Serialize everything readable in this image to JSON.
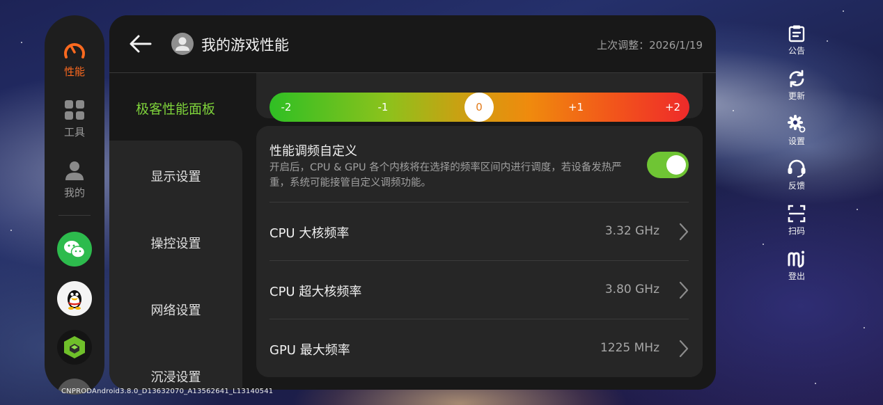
{
  "rail": {
    "items": [
      {
        "label": "性能",
        "icon": "speedometer-icon",
        "active": true
      },
      {
        "label": "工具",
        "icon": "grid-icon"
      },
      {
        "label": "我的",
        "icon": "person-icon"
      }
    ],
    "apps": [
      "wechat-icon",
      "qq-icon",
      "game-app-icon"
    ]
  },
  "header": {
    "title": "我的游戏性能",
    "last_adjust": "上次调整：2026/1/19"
  },
  "subnav": {
    "active": "极客性能面板",
    "items": [
      "显示设置",
      "操控设置",
      "网络设置",
      "沉浸设置"
    ]
  },
  "slider": {
    "ticks": [
      "-2",
      "-1",
      "0",
      "+1",
      "+2"
    ],
    "value": 0
  },
  "custom": {
    "title": "性能调频自定义",
    "description": "开启后，CPU & GPU 各个内核将在选择的频率区间内进行调度，若设备发热严重，系统可能接管自定义调频功能。",
    "enabled": true
  },
  "rows": [
    {
      "name": "CPU 大核频率",
      "value": "3.32 GHz"
    },
    {
      "name": "CPU 超大核频率",
      "value": "3.80 GHz"
    },
    {
      "name": "GPU 最大频率",
      "value": "1225 MHz"
    }
  ],
  "toolbar": [
    {
      "label": "公告",
      "icon": "notice-icon"
    },
    {
      "label": "更新",
      "icon": "refresh-icon"
    },
    {
      "label": "设置",
      "icon": "settings-icon"
    },
    {
      "label": "反馈",
      "icon": "feedback-icon"
    },
    {
      "label": "扫码",
      "icon": "scan-icon"
    },
    {
      "label": "登出",
      "icon": "logout-icon"
    }
  ],
  "build_info": "CNPRODAndroid3.8.0_D13632070_A13562641_L13140541",
  "colors": {
    "accent": "#ff6a1f",
    "green": "#7ed23b",
    "toggle": "#6fc534"
  }
}
